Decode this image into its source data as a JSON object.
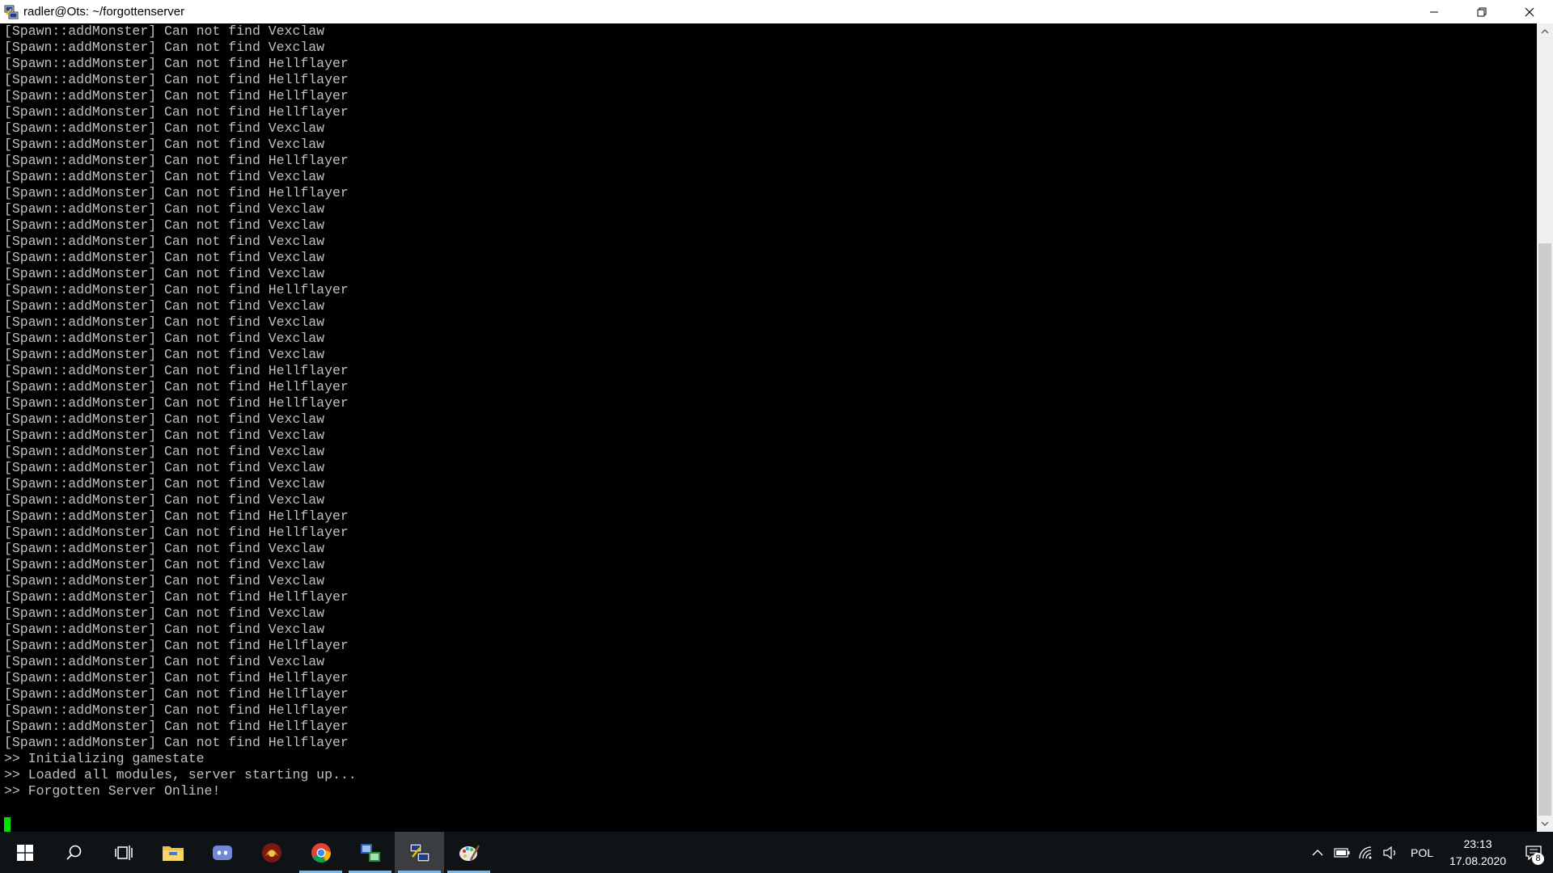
{
  "window": {
    "title": "radler@Ots: ~/forgottenserver",
    "icon": "putty-icon",
    "controls": [
      "minimize-icon",
      "restore-icon",
      "close-icon"
    ]
  },
  "terminal": {
    "lines": [
      "[Spawn::addMonster] Can not find Vexclaw",
      "[Spawn::addMonster] Can not find Vexclaw",
      "[Spawn::addMonster] Can not find Hellflayer",
      "[Spawn::addMonster] Can not find Hellflayer",
      "[Spawn::addMonster] Can not find Hellflayer",
      "[Spawn::addMonster] Can not find Hellflayer",
      "[Spawn::addMonster] Can not find Vexclaw",
      "[Spawn::addMonster] Can not find Vexclaw",
      "[Spawn::addMonster] Can not find Hellflayer",
      "[Spawn::addMonster] Can not find Vexclaw",
      "[Spawn::addMonster] Can not find Hellflayer",
      "[Spawn::addMonster] Can not find Vexclaw",
      "[Spawn::addMonster] Can not find Vexclaw",
      "[Spawn::addMonster] Can not find Vexclaw",
      "[Spawn::addMonster] Can not find Vexclaw",
      "[Spawn::addMonster] Can not find Vexclaw",
      "[Spawn::addMonster] Can not find Hellflayer",
      "[Spawn::addMonster] Can not find Vexclaw",
      "[Spawn::addMonster] Can not find Vexclaw",
      "[Spawn::addMonster] Can not find Vexclaw",
      "[Spawn::addMonster] Can not find Vexclaw",
      "[Spawn::addMonster] Can not find Hellflayer",
      "[Spawn::addMonster] Can not find Hellflayer",
      "[Spawn::addMonster] Can not find Hellflayer",
      "[Spawn::addMonster] Can not find Vexclaw",
      "[Spawn::addMonster] Can not find Vexclaw",
      "[Spawn::addMonster] Can not find Vexclaw",
      "[Spawn::addMonster] Can not find Vexclaw",
      "[Spawn::addMonster] Can not find Vexclaw",
      "[Spawn::addMonster] Can not find Vexclaw",
      "[Spawn::addMonster] Can not find Hellflayer",
      "[Spawn::addMonster] Can not find Hellflayer",
      "[Spawn::addMonster] Can not find Vexclaw",
      "[Spawn::addMonster] Can not find Vexclaw",
      "[Spawn::addMonster] Can not find Vexclaw",
      "[Spawn::addMonster] Can not find Hellflayer",
      "[Spawn::addMonster] Can not find Vexclaw",
      "[Spawn::addMonster] Can not find Vexclaw",
      "[Spawn::addMonster] Can not find Hellflayer",
      "[Spawn::addMonster] Can not find Vexclaw",
      "[Spawn::addMonster] Can not find Hellflayer",
      "[Spawn::addMonster] Can not find Hellflayer",
      "[Spawn::addMonster] Can not find Hellflayer",
      "[Spawn::addMonster] Can not find Hellflayer",
      "[Spawn::addMonster] Can not find Hellflayer",
      ">> Initializing gamestate",
      ">> Loaded all modules, server starting up...",
      ">> Forgotten Server Online!"
    ],
    "text_color": "#c0c0c0",
    "cursor_color": "#00e000"
  },
  "taskbar": {
    "items": [
      {
        "name": "start-button",
        "icon": "windows-logo-icon"
      },
      {
        "name": "search-button",
        "icon": "search-icon"
      },
      {
        "name": "task-view-button",
        "icon": "task-view-icon"
      },
      {
        "name": "file-explorer-button",
        "icon": "folder-icon"
      },
      {
        "name": "discord-button",
        "icon": "discord-icon"
      },
      {
        "name": "game-app-button",
        "icon": "game-app-icon"
      },
      {
        "name": "chrome-button",
        "icon": "chrome-icon",
        "running": true
      },
      {
        "name": "app-windows-button",
        "icon": "app-windows-icon",
        "running": true
      },
      {
        "name": "putty-button",
        "icon": "putty-icon",
        "running": true,
        "active": true
      },
      {
        "name": "paint-button",
        "icon": "paint-icon",
        "running": true
      }
    ],
    "accent_color": "#76b9ed"
  },
  "tray": {
    "icons": [
      "chevron-up-icon",
      "battery-icon",
      "network-icon",
      "volume-icon"
    ],
    "language": "POL",
    "time": "23:13",
    "date": "17.08.2020",
    "notification_count": "8"
  }
}
